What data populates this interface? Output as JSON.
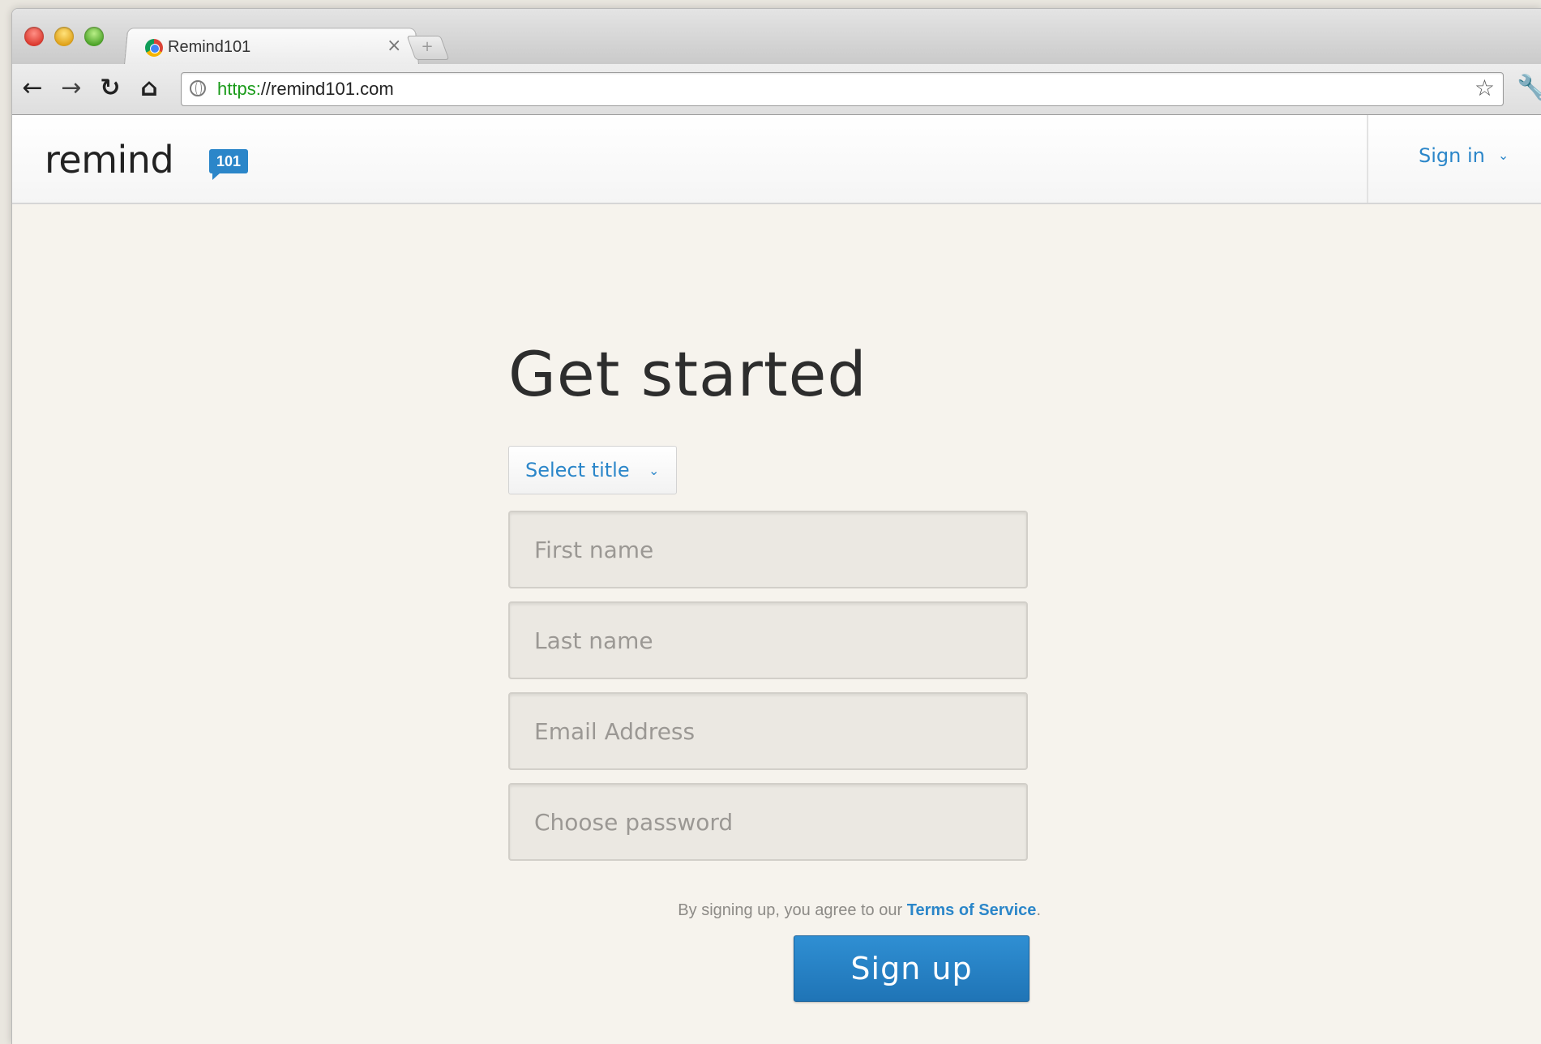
{
  "browser": {
    "tab_title": "Remind101",
    "tab_close": "×",
    "new_tab": "+",
    "url_scheme": "https:",
    "url_rest": "//remind101.com",
    "back": "←",
    "forward": "→",
    "reload": "↻",
    "home": "⌂",
    "star": "☆",
    "wrench": "🔧"
  },
  "header": {
    "logo_text": "remind",
    "logo_badge": "101",
    "signin_label": "Sign in",
    "signin_caret": "⌄"
  },
  "form": {
    "headline": "Get started",
    "title_select": {
      "label": "Select title",
      "caret": "⌄"
    },
    "fields": {
      "first_name": {
        "placeholder": "First name",
        "value": ""
      },
      "last_name": {
        "placeholder": "Last name",
        "value": ""
      },
      "email": {
        "placeholder": "Email Address",
        "value": ""
      },
      "password": {
        "placeholder": "Choose password",
        "value": ""
      }
    },
    "tos_prefix": "By signing up, you agree to our",
    "tos_link": "Terms of Service",
    "tos_suffix": ".",
    "submit_label": "Sign up"
  },
  "colors": {
    "accent": "#2b86c9",
    "page_background": "#f6f3ed",
    "secure_scheme": "#1a9b1a"
  }
}
